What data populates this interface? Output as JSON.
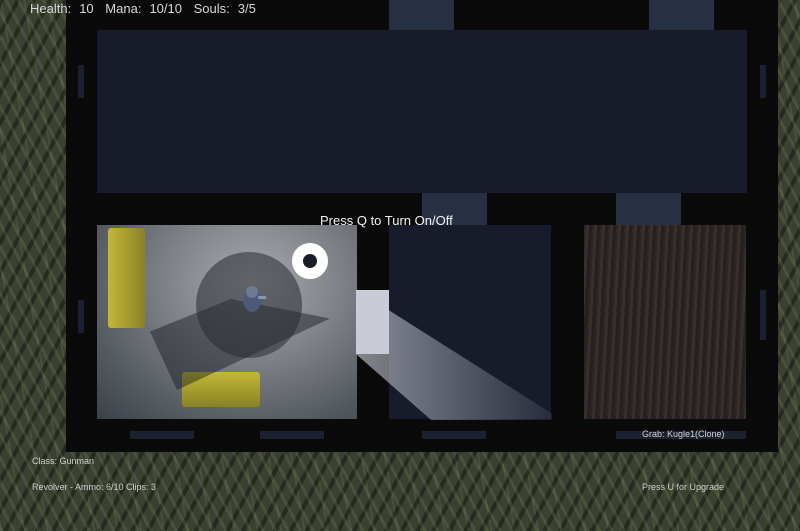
{
  "hud": {
    "health_label": "Health:",
    "health_value": "10",
    "mana_label": "Mana:",
    "mana_value": "10/10",
    "souls_label": "Souls:",
    "souls_value": "3/5",
    "interaction_prompt": "Press Q to Turn On/Off",
    "class_text": "Class: Gunman",
    "weapon_text": "Revolver - Ammo: 6/10 Clips: 3",
    "grab_text": "Grab: Kugle1(Clone)",
    "upgrade_text": "Press U for Upgrade"
  },
  "colors": {
    "wall": "#0b0a0a",
    "floor_dark": "#181c2a",
    "sofa": "#b5ab2e",
    "door": "#263042"
  },
  "icons": {
    "crosshair": "aim-reticle-icon",
    "player": "player-character-icon"
  }
}
